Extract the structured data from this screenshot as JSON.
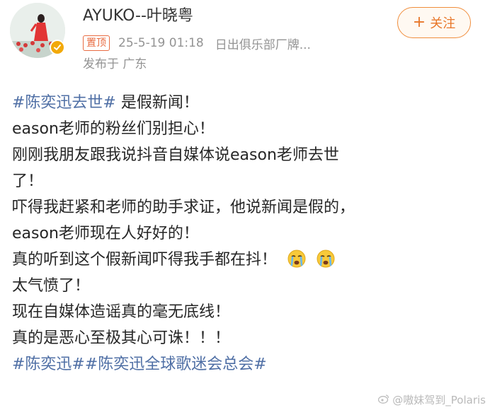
{
  "user": {
    "name": "AYUKO--叶晓粤",
    "verified_icon": "gold-verified-badge-icon"
  },
  "meta": {
    "pin_label": "置顶",
    "time": "25-5-19 01:18",
    "source": "日出俱乐部厂牌...",
    "location": "发布于 广东"
  },
  "actions": {
    "follow_plus": "+",
    "follow_label": "关注"
  },
  "post": {
    "tag_main": "#陈奕迅去世#",
    "line1_rest": " 是假新闻！",
    "line2": "eason老师的粉丝们别担心！",
    "line3": "刚刚我朋友跟我说抖音自媒体说eason老师去世",
    "line4": "了！",
    "line5": "吓得我赶紧和老师的助手求证，他说新闻是假的，",
    "line6": "eason老师现在人好好的！",
    "line7": "真的听到这个假新闻吓得我手都在抖！",
    "emoji_name": "crying-face-icon",
    "line8": "太气愤了！",
    "line9": "现在自媒体造谣真的毫无底线！",
    "line10": "真的是恶心至极其心可诛！！！",
    "tag_footer_1": "#陈奕迅#",
    "tag_footer_2": "#陈奕迅全球歌迷会总会#"
  },
  "watermark": {
    "text": "@嗷妹驾到_Polaris",
    "icon": "weibo-logo-icon"
  },
  "colors": {
    "hashtag": "#4f6fa5",
    "follow_accent": "#e8772a",
    "pin_badge": "#e86b41",
    "verified": "#f2a90a",
    "meta_gray": "#939393"
  }
}
